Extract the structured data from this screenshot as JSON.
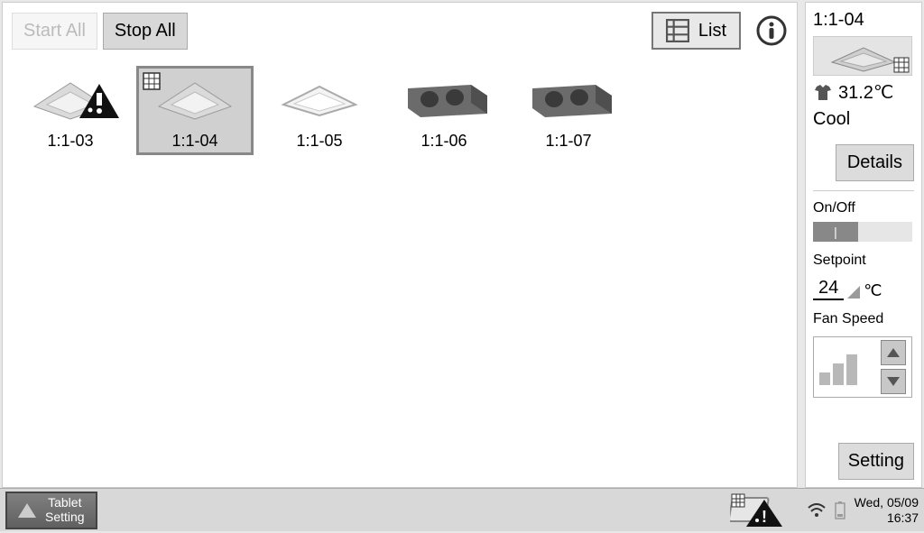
{
  "toolbar": {
    "start_all": "Start All",
    "stop_all": "Stop All",
    "list": "List"
  },
  "units": [
    {
      "id": "1:1-03",
      "type": "cassette",
      "warn": true,
      "selected": false
    },
    {
      "id": "1:1-04",
      "type": "cassette",
      "warn": false,
      "selected": true,
      "grid_badge": true
    },
    {
      "id": "1:1-05",
      "type": "ceiling",
      "warn": false,
      "selected": false
    },
    {
      "id": "1:1-06",
      "type": "duct",
      "warn": false,
      "selected": false
    },
    {
      "id": "1:1-07",
      "type": "duct",
      "warn": false,
      "selected": false
    }
  ],
  "side": {
    "title": "1:1-04",
    "temp": "31.2℃",
    "mode": "Cool",
    "details": "Details",
    "onoff_label": "On/Off",
    "onoff_knob": "|",
    "setpoint_label": "Setpoint",
    "setpoint_value": "24",
    "setpoint_unit": "℃",
    "fan_label": "Fan Speed",
    "setting": "Setting"
  },
  "footer": {
    "tablet_setting": "Tablet\nSetting",
    "date": "Wed, 05/09",
    "time": "16:37"
  }
}
